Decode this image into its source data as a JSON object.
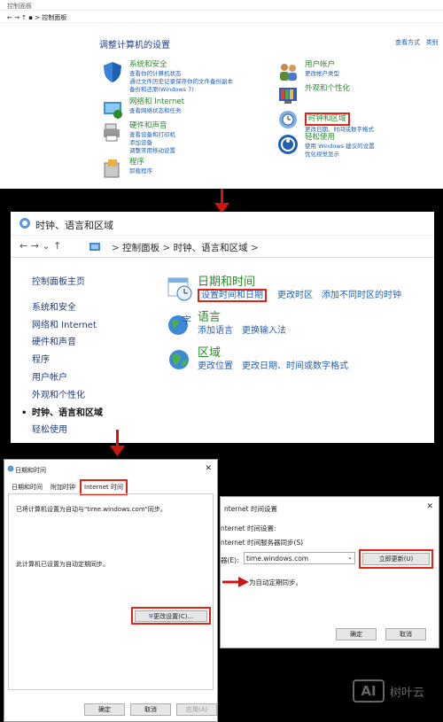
{
  "panel1": {
    "window_title": "控制面板",
    "breadcrumb": "控制面板",
    "heading": "调整计算机的设置",
    "view_by": "查看方式",
    "view_mode": "类别",
    "left_categories": [
      {
        "title": "系统和安全",
        "links": [
          "查看你的计算机状态",
          "通过文件历史记录保存你的文件备份副本",
          "备份和还原(Windows 7)"
        ]
      },
      {
        "title": "网络和 Internet",
        "links": [
          "查看网络状态和任务"
        ]
      },
      {
        "title": "硬件和声音",
        "links": [
          "查看设备和打印机",
          "添加设备",
          "调整常用移动设置"
        ]
      },
      {
        "title": "程序",
        "links": [
          "卸载程序"
        ]
      }
    ],
    "right_categories": [
      {
        "title": "用户帐户",
        "links": [
          "更改帐户类型"
        ]
      },
      {
        "title": "外观和个性化",
        "links": []
      },
      {
        "title": "时钟和区域",
        "links": [
          "更改日期、时间或数字格式"
        ]
      },
      {
        "title": "轻松使用",
        "links": [
          "使用 Windows 建议的设置",
          "优化视觉显示"
        ]
      }
    ]
  },
  "panel2": {
    "window_title": "时钟、语言和区域",
    "breadcrumb": [
      "控制面板",
      "时钟、语言和区域"
    ],
    "sidebar": [
      "控制面板主页",
      "系统和安全",
      "网络和 Internet",
      "硬件和声音",
      "程序",
      "用户帐户",
      "外观和个性化",
      "时钟、语言和区域",
      "轻松使用"
    ],
    "sections": [
      {
        "title": "日期和时间",
        "links": [
          "设置时间和日期",
          "更改时区",
          "添加不同时区的时钟"
        ]
      },
      {
        "title": "语言",
        "links": [
          "添加语言",
          "更换输入法"
        ]
      },
      {
        "title": "区域",
        "links": [
          "更改位置",
          "更改日期、时间或数字格式"
        ]
      }
    ]
  },
  "panel3": {
    "window_title": "日期和时间",
    "tabs": [
      "日期和时间",
      "附加时钟",
      "Internet 时间"
    ],
    "line1": "已将计算机设置为自动与\"time.windows.com\"同步。",
    "line2": "此计算机已设置为自动定期同步。",
    "change_button": "更改设置(C)...",
    "ok": "确定",
    "cancel": "取消",
    "apply": "应用(A)"
  },
  "panel4": {
    "window_title": "nternet 时间设置",
    "subtitle": "nternet 时间设置:",
    "sync_label": "nternet 时间服务器同步(S)",
    "server_label": "器(E):",
    "server_value": "time.windows.com",
    "update_button": "立即更新(U)",
    "status": "为自动定期同步。",
    "ok": "确定",
    "cancel": "取消"
  },
  "watermark": {
    "logo": "AI",
    "text": "树叶云"
  },
  "colors": {
    "highlight": "#e2231a",
    "link": "#1f5fb4",
    "category": "#2a8a2a"
  }
}
